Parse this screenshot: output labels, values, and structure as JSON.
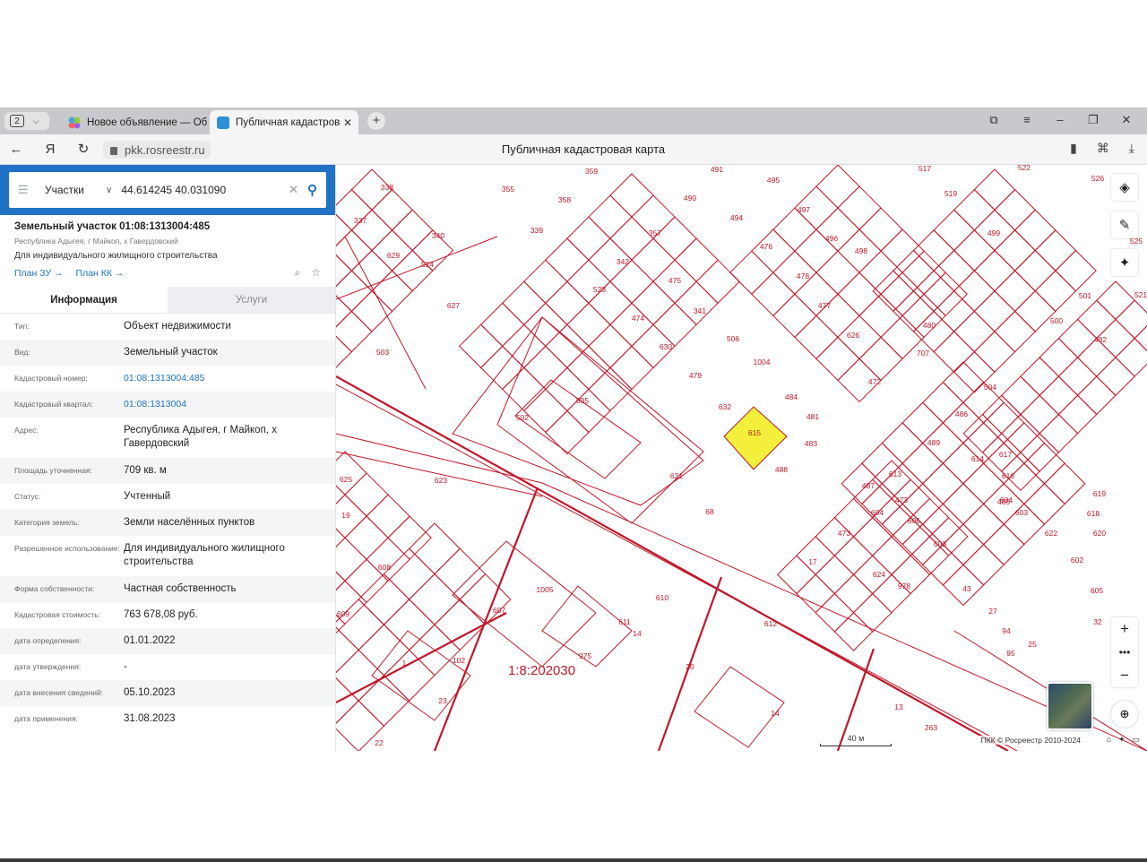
{
  "browser": {
    "tab_count": "2",
    "tabs": [
      {
        "title": "Новое объявление — Об",
        "active": false,
        "favicon_color": "#9b59b6"
      },
      {
        "title": "Публичная кадастрова",
        "active": true,
        "favicon_color": "#2e8fd6"
      }
    ],
    "url": "pkk.rosreestr.ru",
    "page_title": "Публичная кадастровая карта"
  },
  "search": {
    "type": "Участки",
    "value": "44.614245 40.031090"
  },
  "parcel": {
    "title": "Земельный участок 01:08:1313004:485",
    "subtitle": "Республика Адыгея, г Майкоп, х Гавердовский",
    "purpose": "Для индивидуального жилищного строительства",
    "plan_zu": "План ЗУ →",
    "plan_kk": "План КК →"
  },
  "panel_tabs": {
    "info": "Информация",
    "services": "Услуги"
  },
  "info_rows": [
    {
      "key": "Тип:",
      "value": "Объект недвижимости"
    },
    {
      "key": "Вид:",
      "value": "Земельный участок"
    },
    {
      "key": "Кадастровый номер:",
      "value": "01:08:1313004:485",
      "link": true
    },
    {
      "key": "Кадастровый квартал:",
      "value": "01:08:1313004",
      "link": true
    },
    {
      "key": "Адрес:",
      "value": "Республика Адыгея, г Майкоп, х Гавердовский"
    },
    {
      "key": "Площадь уточненная:",
      "value": "709 кв. м"
    },
    {
      "key": "Статус:",
      "value": "Учтенный"
    },
    {
      "key": "Категория земель:",
      "value": "Земли населённых пунктов"
    },
    {
      "key": "Разрешенное использование:",
      "value": "Для индивидуального жилищного строительства"
    },
    {
      "key": "Форма собственности:",
      "value": "Частная собственность"
    },
    {
      "key": "Кадастровая стоимость:",
      "value": "763 678,08 руб."
    },
    {
      "key": "дата определения:",
      "value": "01.01.2022"
    },
    {
      "key": "дата утверждения:",
      "value": "-"
    },
    {
      "key": "дата внесения сведений:",
      "value": "05.10.2023"
    },
    {
      "key": "дата применения:",
      "value": "31.08.2023"
    }
  ],
  "map": {
    "quarter_label": "1:8:202030",
    "scale_label": "40 м",
    "copyright": "ПКК © Росреестр 2010-2024",
    "selected_parcel": "485",
    "highlight_color": "#f4ef3a",
    "line_color": "#c0172a",
    "parcel_labels": [
      "338",
      "355",
      "359",
      "491",
      "495",
      "517",
      "522",
      "526",
      "337",
      "340",
      "358",
      "490",
      "494",
      "497",
      "519",
      "525",
      "629",
      "339",
      "357",
      "476",
      "496",
      "499",
      "521",
      "524",
      "342",
      "475",
      "478",
      "498",
      "501",
      "523",
      "627",
      "474",
      "341",
      "477",
      "480",
      "500",
      "503",
      "506",
      "626",
      "707",
      "482",
      "502",
      "505",
      "630",
      "1004",
      "472",
      "479",
      "484",
      "504",
      "632",
      "481",
      "486",
      "615",
      "483",
      "489",
      "614",
      "617",
      "485",
      "488",
      "613",
      "616",
      "619",
      "621",
      "487",
      "604",
      "618",
      "623",
      "473",
      "603",
      "620",
      "625",
      "68",
      "604",
      "606",
      "622",
      "19",
      "473",
      "603",
      "602",
      "608",
      "624",
      "17",
      "605",
      "1005",
      "610",
      "978",
      "43",
      "32",
      "607",
      "611",
      "27",
      "94",
      "609",
      "612",
      "14",
      "95",
      "102",
      "975",
      "25",
      "1",
      "23",
      "13",
      "20",
      "14",
      "263",
      "22"
    ]
  }
}
